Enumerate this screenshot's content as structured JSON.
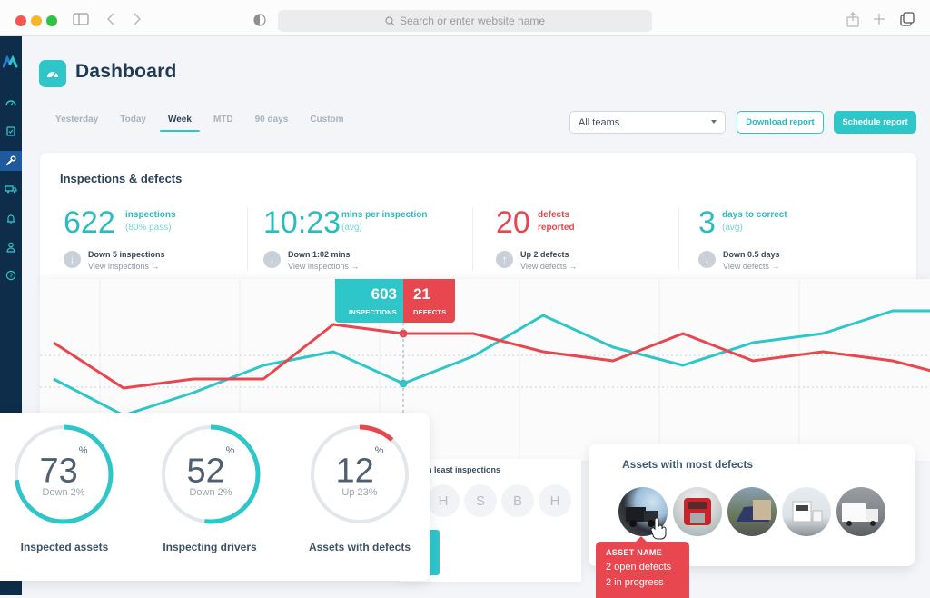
{
  "browser": {
    "address_placeholder": "Search or enter website name",
    "traffic_lights": {
      "close": "#ee5a52",
      "minimize": "#f5b52c",
      "maximize": "#2fc344"
    }
  },
  "sidebar": {
    "items": [
      {
        "icon": "logo-icon"
      },
      {
        "icon": "dashboard-gauge-icon"
      },
      {
        "icon": "clipboard-check-icon"
      },
      {
        "icon": "wrench-icon",
        "active": true
      },
      {
        "icon": "truck-icon"
      },
      {
        "icon": "bell-icon"
      },
      {
        "icon": "user-icon"
      },
      {
        "icon": "help-icon"
      }
    ]
  },
  "header": {
    "title": "Dashboard",
    "tabs": [
      {
        "label": "Yesterday"
      },
      {
        "label": "Today"
      },
      {
        "label": "Week",
        "active": true
      },
      {
        "label": "MTD"
      },
      {
        "label": "90 days"
      },
      {
        "label": "Custom"
      }
    ],
    "team_select": "All teams",
    "download_label": "Download report",
    "schedule_label": "Schedule report"
  },
  "colors": {
    "accent": "#2fc6ca",
    "danger": "#e8474f",
    "navy": "#0d2d4a"
  },
  "inspections": {
    "title": "Inspections & defects",
    "kpis": [
      {
        "value": "622",
        "label_strong": "inspections",
        "label_soft": "(80% pass)",
        "trend": "Down 5 inspections",
        "trend_dir": "down",
        "link": "View inspections →"
      },
      {
        "value": "10:23",
        "label_strong": "mins per inspection",
        "label_soft": "(avg)",
        "trend": "Down 1:02 mins",
        "trend_dir": "down",
        "link": "View inspections →"
      },
      {
        "value": "20",
        "label_strong": "defects reported",
        "label_soft": "",
        "trend": "Up 2 defects",
        "trend_dir": "up",
        "link": "View defects →"
      },
      {
        "value": "3",
        "label_strong": "days to correct",
        "label_soft": "(avg)",
        "trend": "Down 0.5 days",
        "trend_dir": "down",
        "link": "View defects →"
      }
    ]
  },
  "chart_data": {
    "type": "line",
    "title": "",
    "xlabel": "",
    "ylabel": "",
    "x": [
      0,
      1,
      2,
      3,
      4,
      5,
      6,
      7,
      8,
      9,
      10,
      11,
      12,
      13
    ],
    "series": [
      {
        "name": "Inspections",
        "color": "#2fc6ca",
        "values": [
          560,
          520,
          545,
          575,
          590,
          555,
          585,
          630,
          595,
          575,
          600,
          610,
          635,
          635
        ]
      },
      {
        "name": "Defects",
        "color": "#e8474f",
        "values": [
          22,
          17,
          18,
          18,
          24,
          23,
          23,
          21,
          20,
          23,
          20,
          21,
          20,
          18
        ]
      }
    ],
    "tooltip": {
      "index": 5,
      "inspections": 603,
      "inspections_label": "INSPECTIONS",
      "defects": 21,
      "defects_label": "DEFECTS"
    },
    "grid": true
  },
  "gauges": [
    {
      "value": 73,
      "suffix": "%",
      "sub": "Down 2%",
      "label": "Inspected assets",
      "color": "#2fc6ca"
    },
    {
      "value": 52,
      "suffix": "%",
      "sub": "Down 2%",
      "label": "Inspecting drivers",
      "color": "#2fc6ca"
    },
    {
      "value": 12,
      "suffix": "%",
      "sub": "Up 23%",
      "label": "Assets with defects",
      "color": "#e8474f"
    }
  ],
  "least_inspections": {
    "title": "th least inspections",
    "initials": [
      "H",
      "S",
      "B",
      "H"
    ]
  },
  "assets": {
    "title": "Assets with most defects",
    "items": [
      {
        "name": "black-truck"
      },
      {
        "name": "red-truck"
      },
      {
        "name": "blue-truck"
      },
      {
        "name": "white-truck"
      },
      {
        "name": "box-truck"
      }
    ],
    "tooltip": {
      "title": "ASSET NAME",
      "line1": "2 open defects",
      "line2": "2 in progress"
    }
  }
}
